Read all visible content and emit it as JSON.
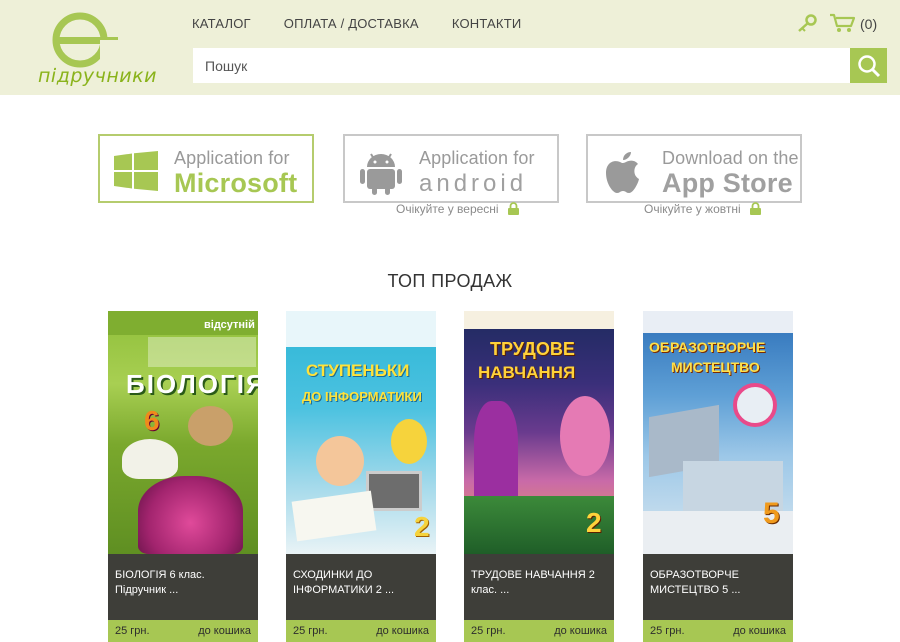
{
  "header": {
    "logo_text": "підручники",
    "nav": [
      "КАТАЛОГ",
      "ОПЛАТА / ДОСТАВКА",
      "КОНТАКТИ"
    ],
    "cart_count": "(0)",
    "search_placeholder": "Пошук"
  },
  "apps": [
    {
      "line1": "Application for",
      "line2": "Microsoft",
      "note": ""
    },
    {
      "line1": "Application for",
      "line2": "android",
      "note": "Очікуйте у вересні"
    },
    {
      "line1": "Download on the",
      "line2": "App Store",
      "note": "Очікуйте у жовтні"
    }
  ],
  "section_title": "ТОП ПРОДАЖ",
  "books": [
    {
      "cover_title": "БІОЛОГІЯ",
      "cover_number": "6",
      "badge": "відсутній",
      "title": "БІОЛОГІЯ 6 клас. Підручник ...",
      "price": "25 грн.",
      "cart": "до кошика"
    },
    {
      "cover_title": "СТУПЕНЬКИ",
      "cover_subtitle": "ДО ІНФОРМАТИКИ",
      "cover_number": "2",
      "title": "СХОДИНКИ ДО ІНФОРМАТИКИ 2 ...",
      "price": "25 грн.",
      "cart": "до кошика"
    },
    {
      "cover_title": "ТРУДОВЕ",
      "cover_subtitle": "НАВЧАННЯ",
      "cover_number": "2",
      "title": "ТРУДОВЕ НАВЧАННЯ 2 клас. ...",
      "price": "25 грн.",
      "cart": "до кошика"
    },
    {
      "cover_title": "ОБРАЗОТВОРЧЕ",
      "cover_subtitle": "МИСТЕЦТВО",
      "cover_number": "5",
      "title": "ОБРАЗОТВОРЧЕ МИСТЕЦТВО 5 ...",
      "price": "25 грн.",
      "cart": "до кошика"
    }
  ],
  "colors": {
    "header_bg": "#eef0d8",
    "accent": "#a7c753",
    "card_dark": "#3e3e39"
  }
}
